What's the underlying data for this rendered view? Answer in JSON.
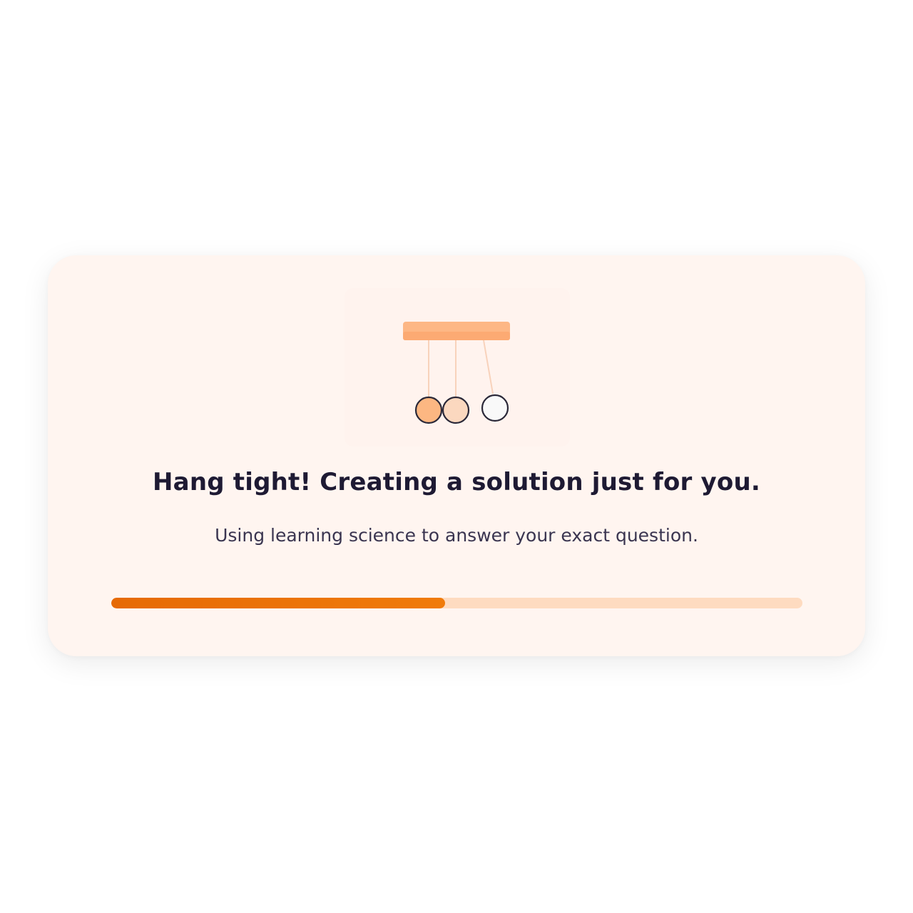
{
  "loader": {
    "headline": "Hang tight! Creating a solution just for you.",
    "subline": "Using learning science to answer your exact question.",
    "progress_percent": 48.3
  },
  "colors": {
    "accent": "#ec6f08",
    "track": "#fedbc0",
    "card_background": "#fff5f0",
    "text_primary": "#1e1a33"
  },
  "illustration": {
    "icon": "newtons-cradle-icon",
    "ball_colors": [
      "#fcb782",
      "#fbd8bf",
      "#f9f9f9"
    ]
  }
}
